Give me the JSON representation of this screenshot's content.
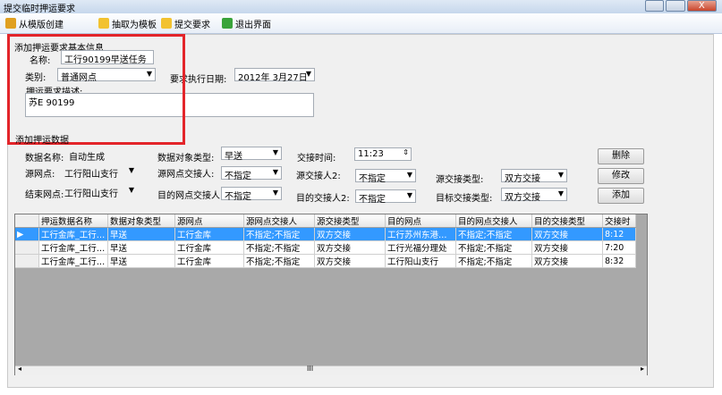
{
  "window": {
    "title": "提交临时押运要求",
    "close_glyph": "X"
  },
  "toolbar": [
    {
      "label": "从模版创建",
      "icon": "create-from-template-icon",
      "color": "#e0a020"
    },
    {
      "label": "抽取为模板",
      "icon": "extract-template-icon",
      "color": "#f2c230"
    },
    {
      "label": "提交要求",
      "icon": "submit-icon",
      "color": "#f2c230"
    },
    {
      "label": "退出界面",
      "icon": "exit-icon",
      "color": "#3aa33a"
    }
  ],
  "basic": {
    "group": "添加押运要求基本信息",
    "name_label": "名称:",
    "name_value": "工行90199早送任务",
    "category_label": "类别:",
    "category_value": "普通网点",
    "date_label": "要求执行日期:",
    "date_value": "2012年 3月27日",
    "desc_label": "押运要求描述:",
    "desc_value": "苏E 90199"
  },
  "data": {
    "group": "添加押运数据",
    "dataname_label": "数据名称:",
    "dataname_value": "自动生成",
    "objtype_label": "数据对象类型:",
    "objtype_value": "早送",
    "handover_time_label": "交接时间:",
    "handover_time_value": "11:23",
    "src_label": "源网点:",
    "src_value": "工行阳山支行",
    "src_person_label": "源网点交接人:",
    "src_person_value": "不指定",
    "src_person2_label": "源交接人2:",
    "src_person2_value": "不指定",
    "src_type_label": "源交接类型:",
    "src_type_value": "双方交接",
    "dst_label": "结束网点:",
    "dst_value": "工行阳山支行",
    "dst_person_label": "目的网点交接人:",
    "dst_person_value": "不指定",
    "dst_person2_label": "目的交接人2:",
    "dst_person2_value": "不指定",
    "dst_type_label": "目标交接类型:",
    "dst_type_value": "双方交接",
    "btn_delete": "删除",
    "btn_edit": "修改",
    "btn_add": "添加"
  },
  "grid": {
    "columns": [
      "押运数据名称",
      "数据对象类型",
      "源网点",
      "源网点交接人",
      "源交接类型",
      "目的网点",
      "目的网点交接人",
      "目的交接类型",
      "交接时"
    ],
    "rows": [
      [
        "工行金库_工行…",
        "早送",
        "工行金库",
        "不指定;不指定",
        "双方交接",
        "工行苏州东港…",
        "不指定;不指定",
        "双方交接",
        "8:12"
      ],
      [
        "工行金库_工行…",
        "早送",
        "工行金库",
        "不指定;不指定",
        "双方交接",
        "工行光福分理处",
        "不指定;不指定",
        "双方交接",
        "7:20"
      ],
      [
        "工行金库_工行…",
        "早送",
        "工行金库",
        "不指定;不指定",
        "双方交接",
        "工行阳山支行",
        "不指定;不指定",
        "双方交接",
        "8:32"
      ]
    ],
    "selected_row": 0,
    "scroll_mid": "III"
  }
}
